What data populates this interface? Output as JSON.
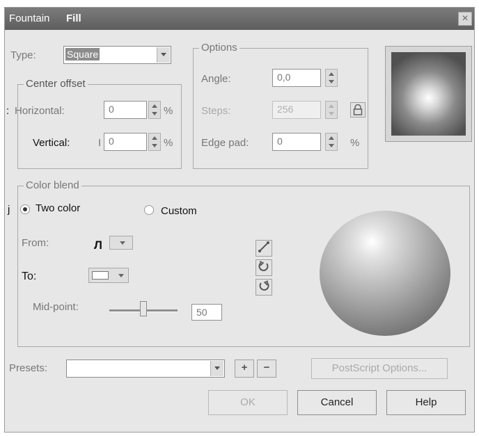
{
  "window": {
    "title_part1": "Fountain",
    "title_part2": "Fill",
    "close_label": "×"
  },
  "type": {
    "label": "Type:",
    "value": "Square"
  },
  "center_offset": {
    "title": "Center offset",
    "prefix_colon": ":",
    "horizontal_label": "Horizontal:",
    "horizontal_value": "0",
    "horizontal_unit": "%",
    "vertical_label": "Vertical:",
    "vertical_prefix": "I",
    "vertical_value": "0",
    "vertical_unit": "%"
  },
  "options": {
    "title": "Options",
    "angle_label": "Angle:",
    "angle_value": "0,0",
    "steps_label": "Steps:",
    "steps_value": "256",
    "edge_pad_label": "Edge pad:",
    "edge_pad_value": "0",
    "edge_pad_unit": "%"
  },
  "color_blend": {
    "title": "Color blend",
    "radio_prefix": "j",
    "two_color_label": "Two color",
    "custom_label": "Custom",
    "selected": "Two color",
    "from_label": "From:",
    "from_glyph": "Л",
    "to_label": "To:",
    "midpoint_label": "Mid-point:",
    "midpoint_value": "50"
  },
  "direction_icons": [
    "line-direction-icon",
    "counterclockwise-icon",
    "clockwise-icon"
  ],
  "presets": {
    "label": "Presets:",
    "value": "",
    "add_symbol": "+",
    "remove_symbol": "−",
    "postscript_label": "PostScript Options..."
  },
  "buttons": {
    "ok": "OK",
    "cancel": "Cancel",
    "help": "Help"
  },
  "colors": {
    "titlebar": "#6b6b6b",
    "dialog_bg": "#e7e7e7",
    "field_bg": "#ffffff"
  }
}
